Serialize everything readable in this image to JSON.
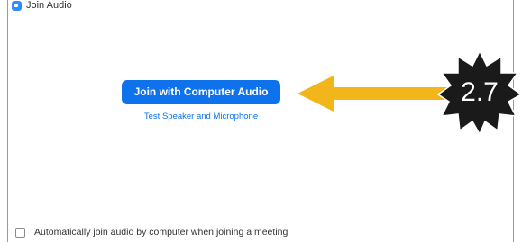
{
  "window": {
    "title": "Join Audio",
    "icon": "zoom-app-icon"
  },
  "main": {
    "join_button_label": "Join with Computer Audio",
    "test_link_label": "Test Speaker and Microphone"
  },
  "footer": {
    "auto_join_label": "Automatically join audio by computer when joining a meeting",
    "auto_join_checked": false
  },
  "annotation": {
    "badge_label": "2.7",
    "arrow_color": "#f2b61b",
    "badge_color": "#1a1a1a"
  },
  "colors": {
    "accent": "#0e72ed"
  }
}
